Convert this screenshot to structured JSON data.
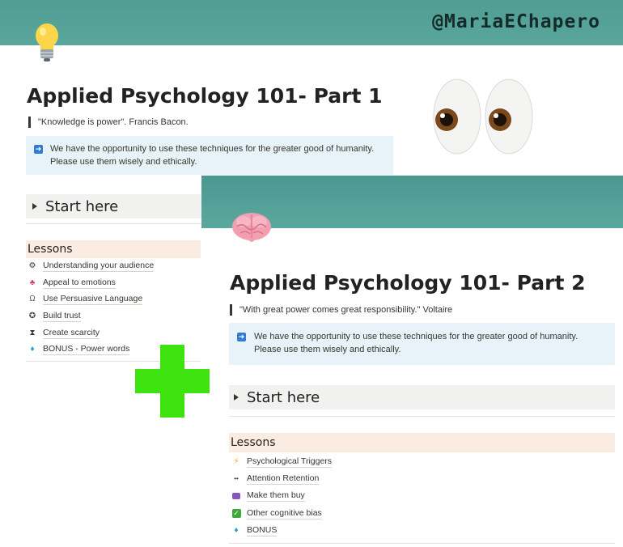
{
  "watermark": {
    "handle": "@MariaEChapero"
  },
  "page1": {
    "icon": "lightbulb-icon",
    "title": "Applied Psychology 101- Part 1",
    "quote": "\"Knowledge is power\". Francis Bacon.",
    "callout": "We have the opportunity to use these techniques for the greater good of humanity. Please use them wisely and ethically.",
    "toggle_label": "Start here",
    "lessons_heading": "Lessons",
    "lessons": [
      {
        "icon": "brain-gear-icon",
        "label": "Understanding your audience"
      },
      {
        "icon": "puppet-icon",
        "label": "Appeal to emotions"
      },
      {
        "icon": "horseshoe-icon",
        "label": "Use Persuasive Language"
      },
      {
        "icon": "handshake-icon",
        "label": "Build trust"
      },
      {
        "icon": "hourglass-icon",
        "label": "Create scarcity"
      },
      {
        "icon": "gem-icon",
        "label": "BONUS - Power words"
      }
    ]
  },
  "decorations": {
    "eyes": "eyes-emoji",
    "plus": "green-plus",
    "plus_color": "#3ee30f"
  },
  "page2": {
    "icon": "brain-icon",
    "title": "Applied Psychology 101- Part 2",
    "quote": "\"With great power comes great responsibility.\" Voltaire",
    "callout": "We have the opportunity to use these techniques for the greater good of humanity. Please use them wisely and ethically.",
    "toggle_label": "Start here",
    "lessons_heading": "Lessons",
    "lessons": [
      {
        "icon": "lightning-icon",
        "label": "Psychological Triggers"
      },
      {
        "icon": "eyes-icon",
        "label": "Attention Retention"
      },
      {
        "icon": "purse-icon",
        "label": "Make them buy"
      },
      {
        "icon": "check-icon",
        "label": "Other cognitive bias"
      },
      {
        "icon": "gem-icon",
        "label": "BONUS"
      }
    ]
  },
  "colors": {
    "cover": "#55a198",
    "callout_bg": "#e7f3f8",
    "toggle_bg": "#f1f1ef",
    "lessons_bg": "#fbece1",
    "arrow_icon": "#2f7dd3"
  }
}
